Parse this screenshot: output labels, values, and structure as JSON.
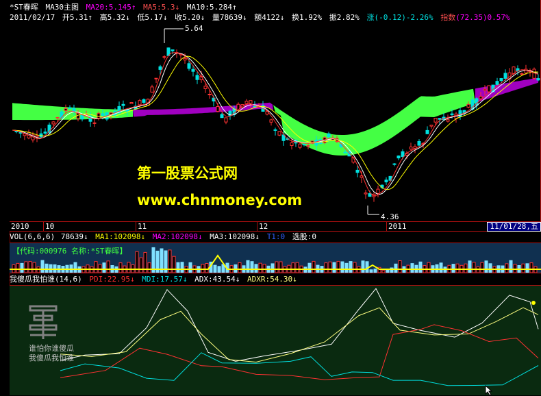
{
  "colors": {
    "up": "#ff3232",
    "down": "#00e0e0",
    "cloud_green": "#44ff44",
    "cloud_magenta": "#a000c0",
    "ma5": "#ffffff",
    "ma10": "#ffff00",
    "ma20": "#ff00ff",
    "panel_bg": "#0a2a10",
    "vol_bg": "#103050",
    "watermark": "#ffff00"
  },
  "main": {
    "stock_label": "*ST春晖",
    "indicator_name": "MA30主图",
    "ma20": "MA20:5.145↑",
    "ma5": "MA5:5.3↓",
    "ma10": "MA10:5.284↑",
    "date": "2011/02/17",
    "open": "开5.31↑",
    "high": "高5.32↓",
    "low": "低5.17↓",
    "close": "收5.20↓",
    "vol": "量78639↓",
    "amount": "额4122↓",
    "turnover": "换1.92%",
    "amplitude": "振2.82%",
    "change": "涨(-0.12)-2.26%",
    "index_label": "指数",
    "index_value": "(72.35)0.57%",
    "high_marker": "5.64",
    "low_marker": "4.36"
  },
  "watermark": {
    "line1": "第一股票公式网",
    "line2": "www.chnmoney.com"
  },
  "time_axis": {
    "ticks": [
      "2010",
      "10",
      "11",
      "12",
      "2011"
    ],
    "current_date": "11/01/28,五"
  },
  "volume": {
    "label": "VOL(6,6,6)",
    "v1": "78639↓",
    "ma1": "MA1:102098↓",
    "ma2": "MA2:102098↓",
    "ma3": "MA3:102098↓",
    "t1": "T1:0",
    "xuangu": "选股:0",
    "code_text": "【代码:000976 名称:*ST春晖】"
  },
  "indicator": {
    "name": "我傻瓜我怕谁(14,6)",
    "pdi": "PDI:22.95↓",
    "mdi": "MDI:17.57↓",
    "adx": "ADX:43.54↓",
    "adxr": "ADXR:54.30↓",
    "logo_text1": "谁怕你谁傻瓜",
    "logo_text2": "我傻瓜我怕谁"
  }
}
